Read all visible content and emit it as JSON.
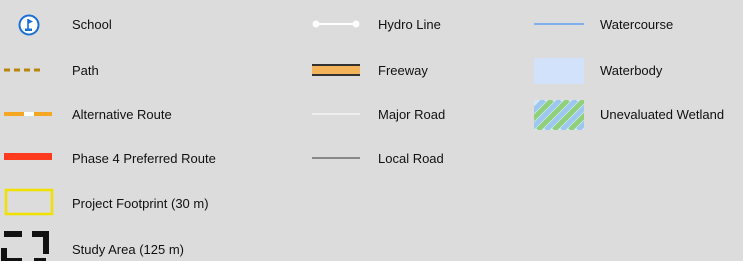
{
  "legend": {
    "school": "School",
    "path": "Path",
    "alternative_route": "Alternative Route",
    "phase4_preferred_route": "Phase 4 Preferred Route",
    "project_footprint": "Project Footprint (30 m)",
    "study_area": "Study Area (125 m)",
    "hydro_line": "Hydro Line",
    "freeway": "Freeway",
    "major_road": "Major Road",
    "local_road": "Local Road",
    "watercourse": "Watercourse",
    "waterbody": "Waterbody",
    "unevaluated_wetland": "Unevaluated Wetland"
  },
  "colors": {
    "background": "#dcdcdc",
    "school_blue": "#1a6fd6",
    "path": "#b8860b",
    "alternative_route": "#f5a623",
    "phase4_route": "#ff3b1f",
    "project_footprint": "#f0e000",
    "study_area": "#111111",
    "hydro_line": "#ffffff",
    "freeway_fill": "#f2b35a",
    "freeway_edge": "#333333",
    "major_road": "#eeeeee",
    "local_road": "#888888",
    "watercourse": "#7fb0ee",
    "waterbody": "#d2e2fa",
    "wetland_blue": "#9cc8f0",
    "wetland_green": "#8fd07a"
  },
  "icons": [
    "school-icon"
  ]
}
